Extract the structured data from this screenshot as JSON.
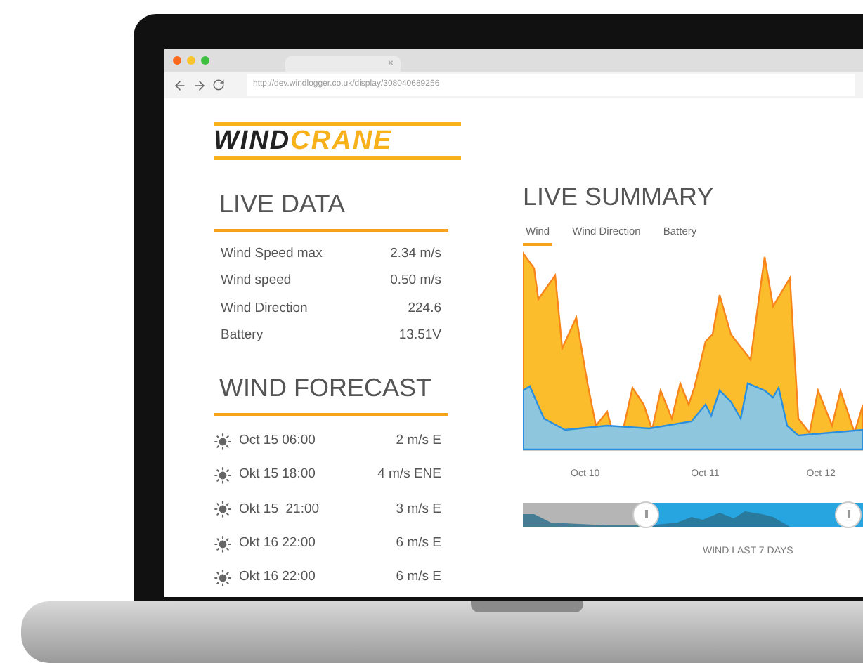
{
  "browser": {
    "url": "http://dev.windlogger.co.uk/display/308040689256",
    "tab_close": "×"
  },
  "logo": {
    "dark": "WIND",
    "accent": "CRANE"
  },
  "live_data": {
    "title": "LIVE DATA",
    "rows": [
      {
        "label": "Wind Speed max",
        "value": "2.34 m/s"
      },
      {
        "label": "Wind speed",
        "value": "0.50 m/s"
      },
      {
        "label": "Wind Direction",
        "value": "224.6"
      },
      {
        "label": "Battery",
        "value": "13.51V"
      }
    ]
  },
  "wind_forecast": {
    "title": "WIND FORECAST",
    "rows": [
      {
        "time": "Oct 15 06:00",
        "wind": "2 m/s E"
      },
      {
        "time": "Okt 15 18:00",
        "wind": "4 m/s ENE"
      },
      {
        "time": "Okt 15  21:00",
        "wind": "3 m/s E"
      },
      {
        "time": "Okt 16 22:00",
        "wind": "6 m/s E"
      },
      {
        "time": "Okt 16 22:00",
        "wind": "6 m/s E"
      }
    ]
  },
  "live_summary": {
    "title": "LIVE SUMMARY",
    "tabs": [
      {
        "label": "Wind",
        "selected": true
      },
      {
        "label": "Wind Direction",
        "selected": false
      },
      {
        "label": "Battery",
        "selected": false
      }
    ],
    "x_labels": [
      "Oct 10",
      "Oct 11",
      "Oct 12"
    ],
    "range_caption": "WIND LAST 7 DAYS"
  }
}
